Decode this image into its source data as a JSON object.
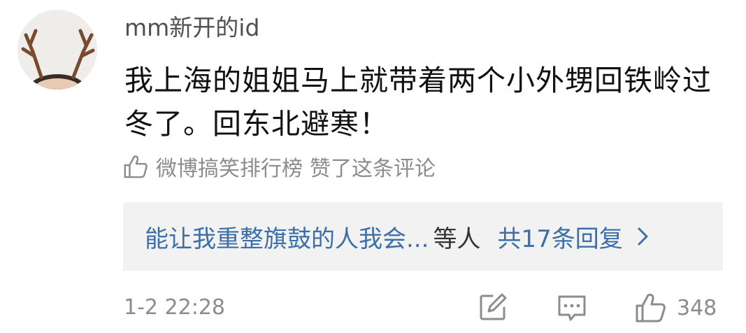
{
  "comment": {
    "username": "mm新开的id",
    "text": "我上海的姐姐马上就带着两个小外甥回铁岭过冬了。回东北避寒！"
  },
  "liked_note": {
    "icon": "thumb-up-outline-icon",
    "liker": "微博搞笑排行榜",
    "suffix": "赞了这条评论"
  },
  "replies": {
    "names": "能让我重整旗鼓的人我会...",
    "etc": "等人",
    "count_label": "共17条回复",
    "chevron": "chevron-right-icon"
  },
  "footer": {
    "timestamp": "1-2 22:28",
    "edit_icon": "edit-icon",
    "comment_icon": "comment-icon",
    "like_icon": "thumb-up-icon",
    "like_count": "348"
  },
  "colors": {
    "link": "#3c6fa8",
    "muted": "#8c8c8c",
    "reply_bg": "#f2f2f2"
  }
}
